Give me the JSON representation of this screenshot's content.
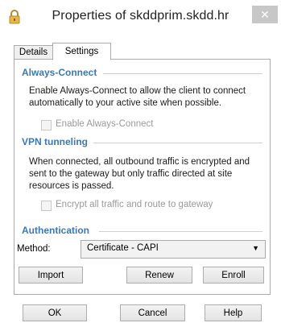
{
  "window": {
    "title": "Properties of skddprim.skdd.hr",
    "close_label": "✕"
  },
  "tabs": [
    {
      "label": "Details"
    },
    {
      "label": "Settings"
    }
  ],
  "always_connect": {
    "header": "Always-Connect",
    "description": "Enable Always-Connect to allow the client to connect automatically to your active site when possible.",
    "checkbox_label": "Enable Always-Connect"
  },
  "vpn_tunneling": {
    "header": "VPN tunneling",
    "description": "When connected, all outbound traffic is encrypted and sent to the gateway but only traffic directed at site resources is passed.",
    "checkbox_label": "Encrypt all traffic and route to gateway"
  },
  "authentication": {
    "header": "Authentication",
    "method_label": "Method:",
    "method_value": "Certificate - CAPI",
    "import_label": "Import",
    "renew_label": "Renew",
    "enroll_label": "Enroll"
  },
  "footer": {
    "ok_label": "OK",
    "cancel_label": "Cancel",
    "help_label": "Help"
  },
  "colors": {
    "section_header": "#3c78b4",
    "app_icon": "#e8b54a"
  }
}
